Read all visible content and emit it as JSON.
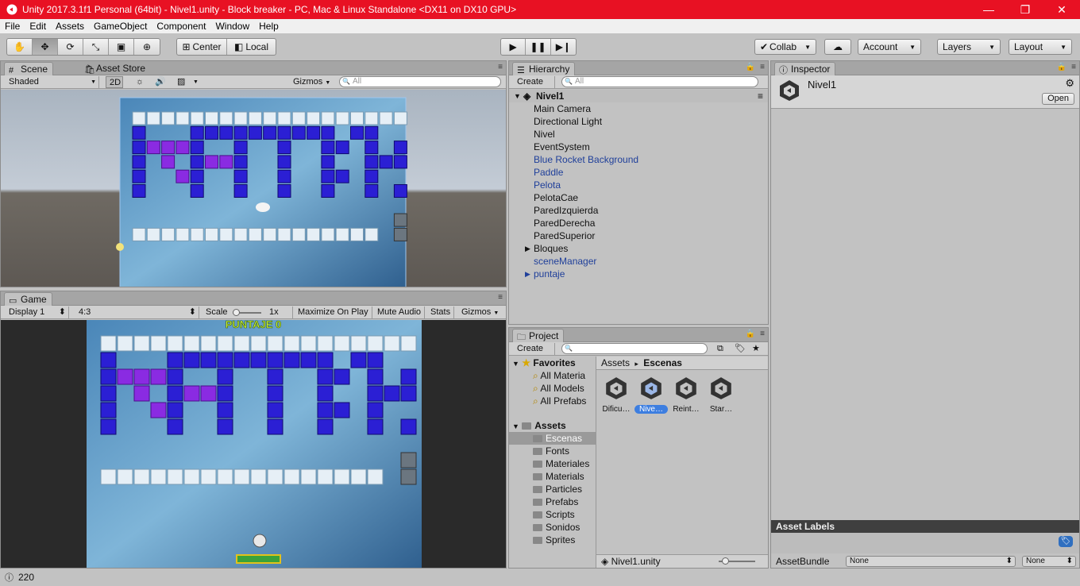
{
  "window": {
    "title": "Unity 2017.3.1f1 Personal (64bit) - Nivel1.unity - Block breaker - PC, Mac & Linux Standalone <DX11 on DX10 GPU>",
    "minimize": "—",
    "restore": "❐",
    "close": "✕"
  },
  "menu": [
    "File",
    "Edit",
    "Assets",
    "GameObject",
    "Component",
    "Window",
    "Help"
  ],
  "toolbar": {
    "pivot": "Center",
    "space": "Local",
    "collab": "Collab",
    "account": "Account",
    "layers": "Layers",
    "layout": "Layout"
  },
  "scene": {
    "tab": "Scene",
    "tab2": "Asset Store",
    "shading": "Shaded",
    "mode2d": "2D",
    "gizmos": "Gizmos",
    "search_placeholder": "All"
  },
  "game": {
    "tab": "Game",
    "display": "Display 1",
    "aspect": "4:3",
    "scale_label": "Scale",
    "scale_value": "1x",
    "maximize": "Maximize On Play",
    "mute": "Mute Audio",
    "stats": "Stats",
    "gizmos": "Gizmos",
    "score_text": "PUNTAJE 0"
  },
  "hierarchy": {
    "tab": "Hierarchy",
    "create": "Create",
    "search_placeholder": "All",
    "scene_name": "Nivel1",
    "items": [
      {
        "label": "Main Camera",
        "prefab": false,
        "expandable": false
      },
      {
        "label": "Directional Light",
        "prefab": false,
        "expandable": false
      },
      {
        "label": "Nivel",
        "prefab": false,
        "expandable": false
      },
      {
        "label": "EventSystem",
        "prefab": false,
        "expandable": false
      },
      {
        "label": "Blue Rocket Background",
        "prefab": true,
        "expandable": false
      },
      {
        "label": "Paddle",
        "prefab": true,
        "expandable": false
      },
      {
        "label": "Pelota",
        "prefab": true,
        "expandable": false
      },
      {
        "label": "PelotaCae",
        "prefab": false,
        "expandable": false
      },
      {
        "label": "ParedIzquierda",
        "prefab": false,
        "expandable": false
      },
      {
        "label": "ParedDerecha",
        "prefab": false,
        "expandable": false
      },
      {
        "label": "ParedSuperior",
        "prefab": false,
        "expandable": false
      },
      {
        "label": "Bloques",
        "prefab": false,
        "expandable": true
      },
      {
        "label": "sceneManager",
        "prefab": true,
        "expandable": false
      },
      {
        "label": "puntaje",
        "prefab": true,
        "expandable": true
      }
    ]
  },
  "project": {
    "tab": "Project",
    "create": "Create",
    "favorites_label": "Favorites",
    "favorites": [
      "All Materia",
      "All Models",
      "All Prefabs"
    ],
    "assets_label": "Assets",
    "folders": [
      "Escenas",
      "Fonts",
      "Materiales",
      "Materials",
      "Particles",
      "Prefabs",
      "Scripts",
      "Sonidos",
      "Sprites"
    ],
    "breadcrumb_root": "Assets",
    "breadcrumb_arrow": "▸",
    "breadcrumb_current": "Escenas",
    "assets": [
      "Dificu…",
      "Nive…",
      "Reint…",
      "Star…"
    ],
    "selected_file": "Nivel1.unity"
  },
  "inspector": {
    "tab": "Inspector",
    "object_name": "Nivel1",
    "open_button": "Open",
    "asset_labels": "Asset Labels",
    "assetbundle_label": "AssetBundle",
    "assetbundle_value": "None",
    "variant_value": "None"
  },
  "status": {
    "text": "220"
  }
}
